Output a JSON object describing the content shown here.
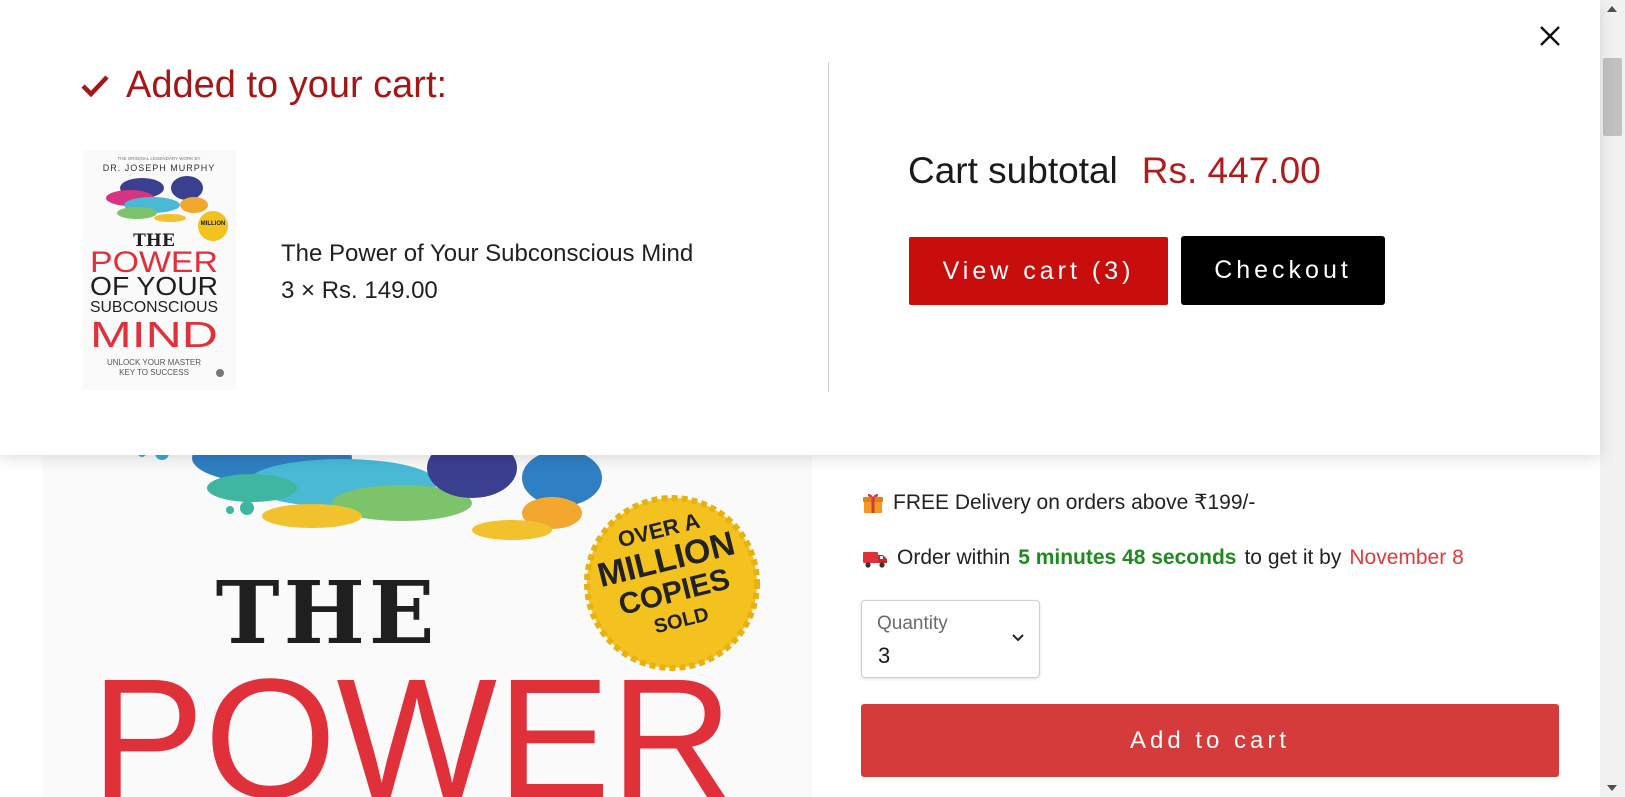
{
  "drawer": {
    "title": "Added to your cart:",
    "item": {
      "name": "The Power of Your Subconscious Mind",
      "quantity_price": "3 × Rs. 149.00"
    },
    "subtotal_label": "Cart subtotal",
    "subtotal_value": "Rs. 447.00",
    "view_cart_label": "View cart (3)",
    "checkout_label": "Checkout"
  },
  "book_cover": {
    "top_small": "THE ORIGINAL LEGENDARY WORK BY",
    "author": "DR. JOSEPH MURPHY",
    "line_the": "THE",
    "line_power": "POWER",
    "line_of_your": "OF YOUR",
    "line_sub": "SUBCONSCIOUS",
    "line_mind": "MIND",
    "tagline_1": "UNLOCK YOUR MASTER",
    "tagline_2": "KEY TO SUCCESS",
    "badge_1": "OVER A",
    "badge_2": "MILLION",
    "badge_3": "COPIES",
    "badge_4": "SOLD"
  },
  "product": {
    "delivery_text": "FREE Delivery on orders above ₹199/-",
    "order_prefix": "Order within",
    "order_countdown": "5 minutes 48 seconds",
    "order_middle": "to get it by",
    "order_date": "November 8",
    "quantity_label": "Quantity",
    "quantity_value": "3",
    "add_to_cart_label": "Add to cart"
  },
  "colors": {
    "brand_red": "#c80d0d",
    "title_red": "#a51616",
    "add_button": "#d63b3b",
    "countdown_green": "#1f8a1f",
    "date_red": "#e03a3a"
  },
  "icons": [
    "close-icon",
    "check-icon",
    "gift-icon",
    "truck-icon",
    "chevron-down-icon"
  ]
}
